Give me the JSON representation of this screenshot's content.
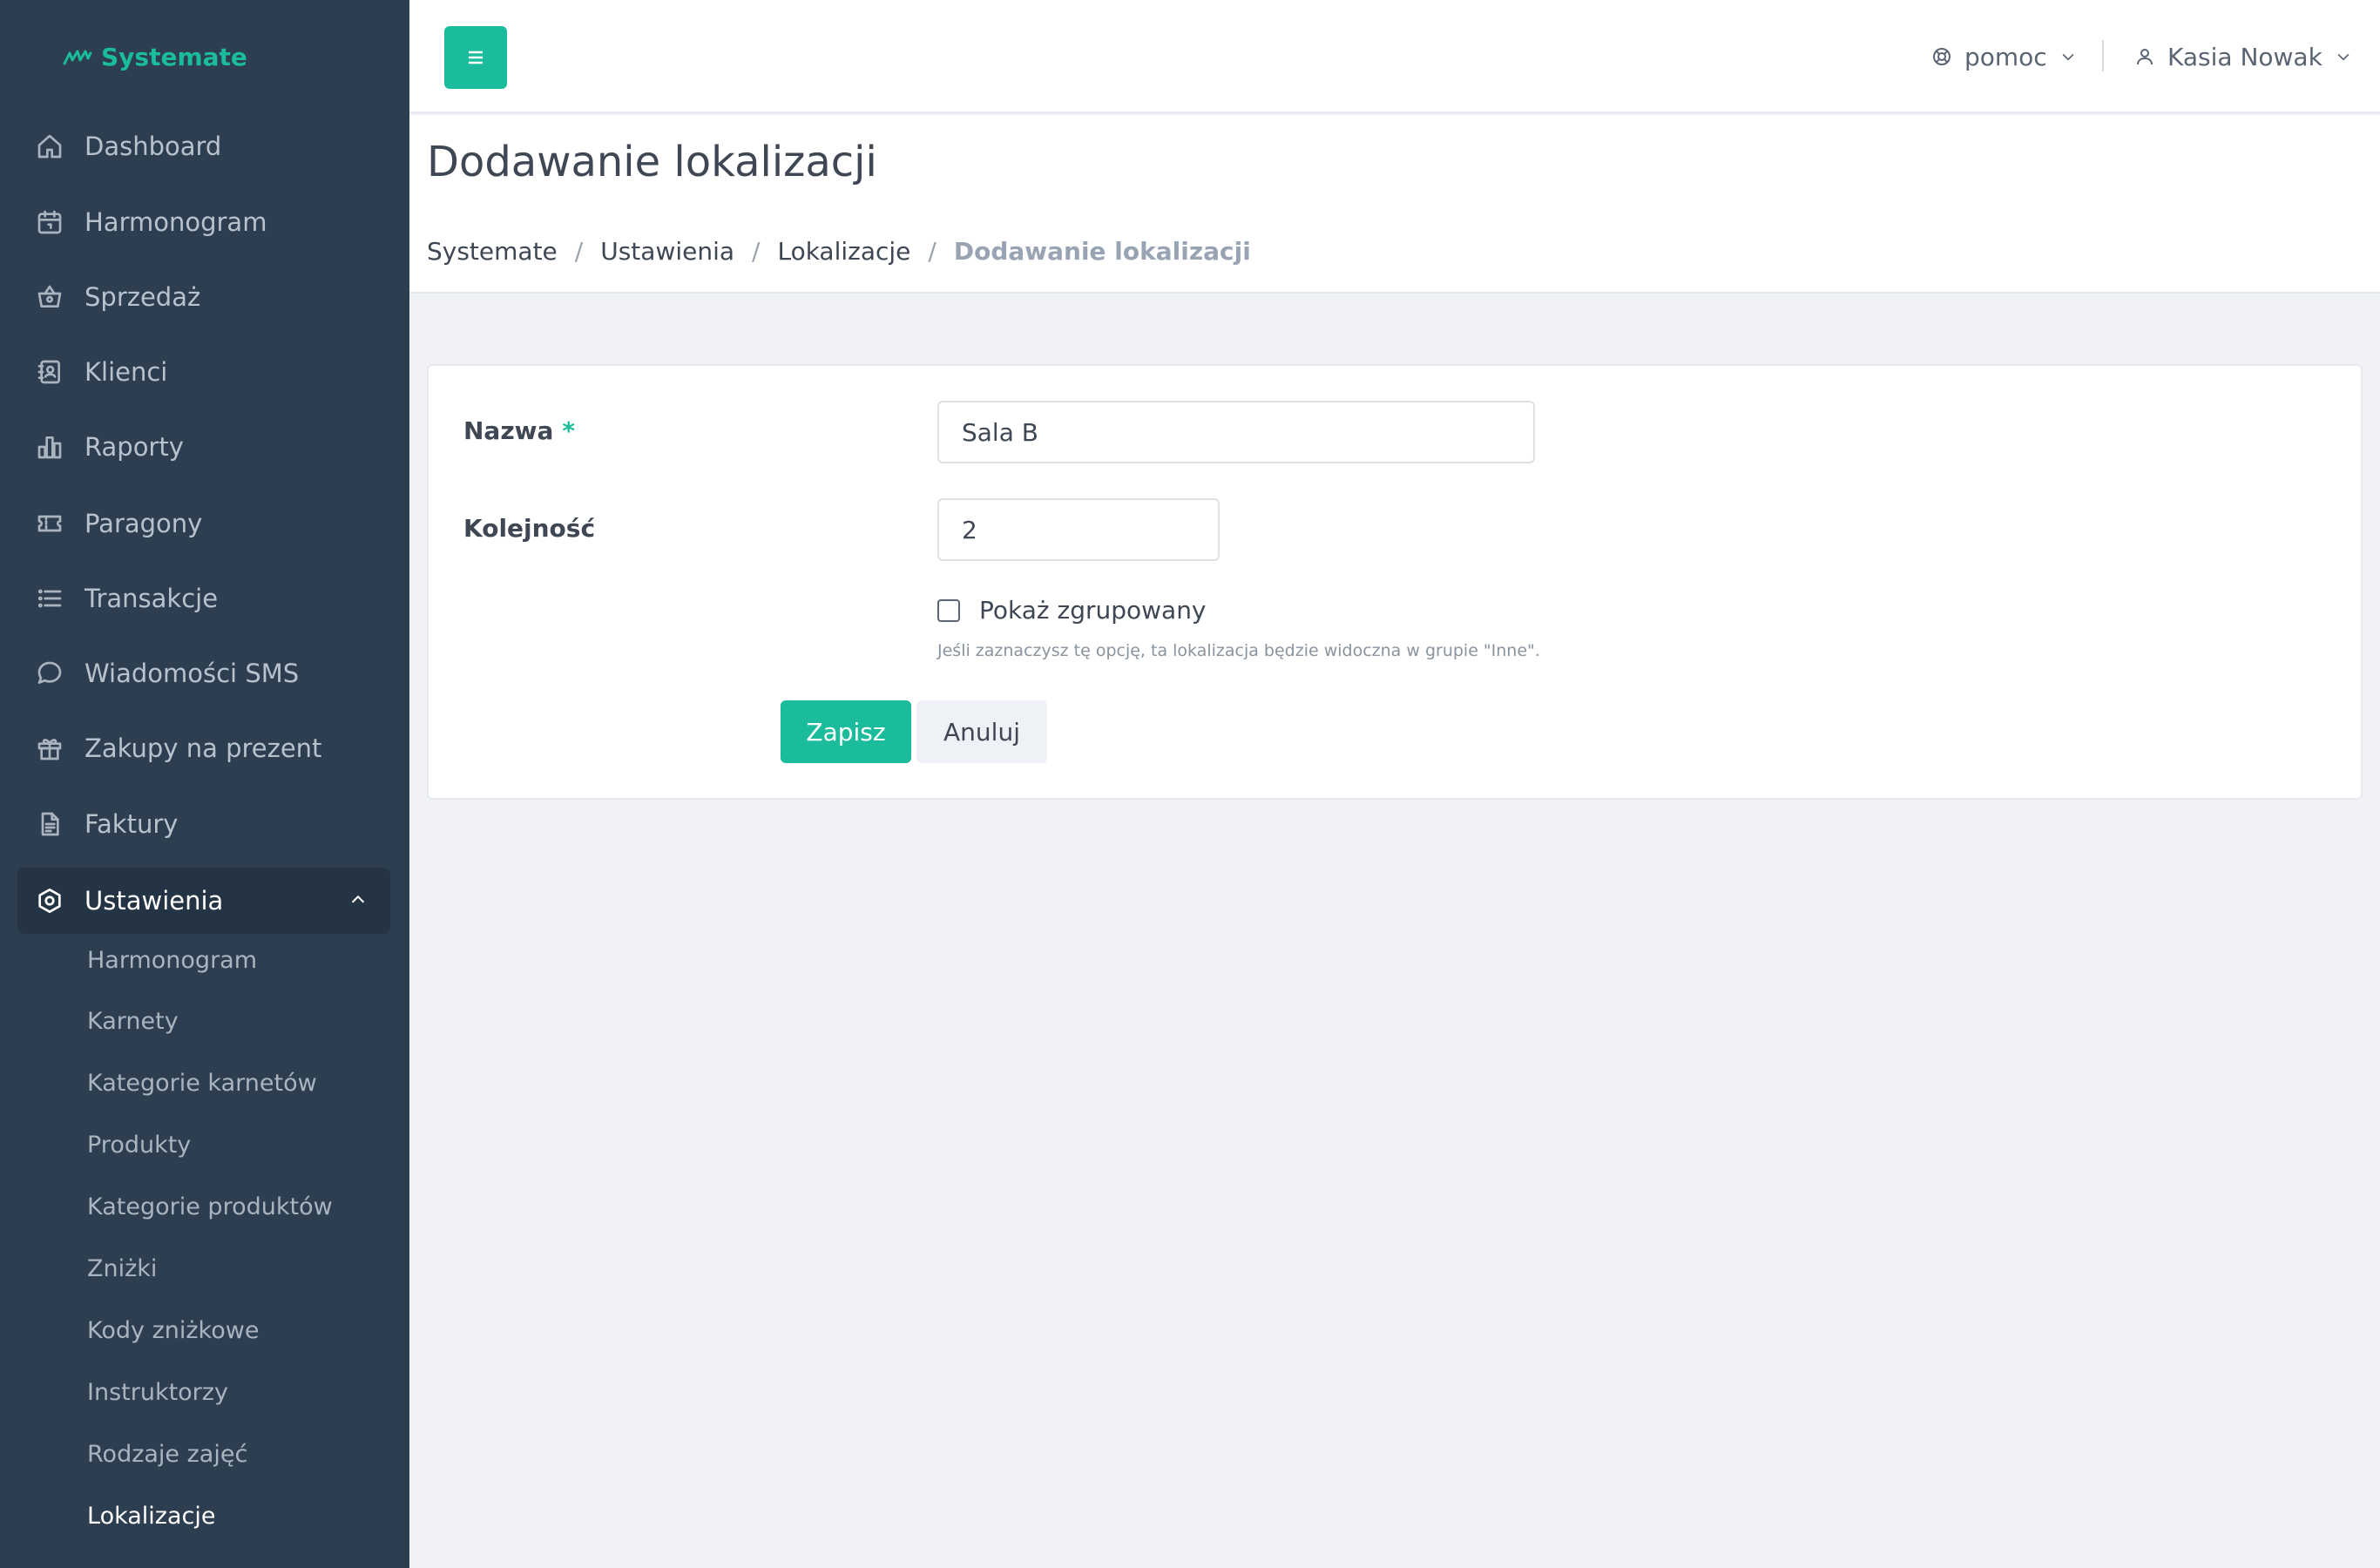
{
  "brand": {
    "name": "Systemate",
    "color": "#1abc9c",
    "icon": "brand-logo-icon"
  },
  "sidebar": {
    "items": [
      {
        "label": "Dashboard",
        "icon": "home-icon"
      },
      {
        "label": "Harmonogram",
        "icon": "calendar-icon"
      },
      {
        "label": "Sprzedaż",
        "icon": "basket-icon"
      },
      {
        "label": "Klienci",
        "icon": "contacts-icon"
      },
      {
        "label": "Raporty",
        "icon": "bar-chart-icon"
      },
      {
        "label": "Paragony",
        "icon": "ticket-icon"
      },
      {
        "label": "Transakcje",
        "icon": "list-icon"
      },
      {
        "label": "Wiadomości SMS",
        "icon": "chat-icon"
      },
      {
        "label": "Zakupy na prezent",
        "icon": "gift-icon"
      },
      {
        "label": "Faktury",
        "icon": "document-icon"
      },
      {
        "label": "Ustawienia",
        "icon": "settings-icon",
        "active": true
      }
    ],
    "settings_sub": [
      "Harmonogram",
      "Karnety",
      "Kategorie karnetów",
      "Produkty",
      "Kategorie produktów",
      "Zniżki",
      "Kody zniżkowe",
      "Instruktorzy",
      "Rodzaje zajęć",
      "Lokalizacje"
    ],
    "active_sub": "Lokalizacje"
  },
  "topbar": {
    "help_label": "pomoc",
    "user_name": "Kasia Nowak"
  },
  "page": {
    "title": "Dodawanie lokalizacji",
    "breadcrumb": [
      "Systemate",
      "Ustawienia",
      "Lokalizacje",
      "Dodawanie lokalizacji"
    ]
  },
  "form": {
    "name_label": "Nazwa",
    "name_required_mark": "*",
    "name_value": "Sala B",
    "order_label": "Kolejność",
    "order_value": "2",
    "grouped_label": "Pokaż zgrupowany",
    "grouped_checked": false,
    "grouped_hint": "Jeśli zaznaczysz tę opcję, ta lokalizacja będzie widoczna w grupie \"Inne\".",
    "save_label": "Zapisz",
    "cancel_label": "Anuluj"
  },
  "colors": {
    "sidebar_bg": "#2c3e50",
    "accent": "#1abc9c",
    "page_bg": "#f0f2f6"
  }
}
